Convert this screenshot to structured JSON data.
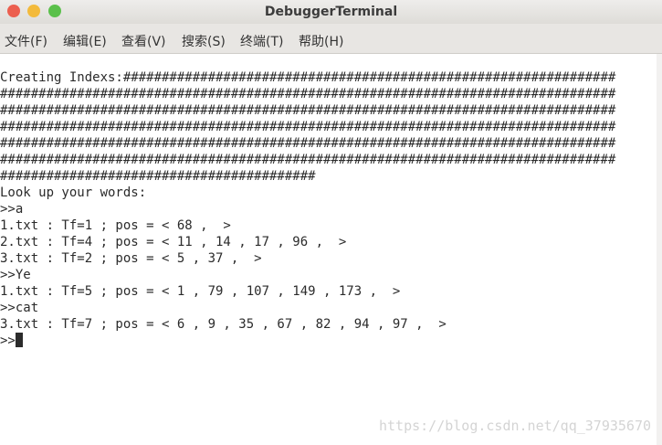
{
  "window": {
    "title": "DebuggerTerminal"
  },
  "menu": [
    "文件(F)",
    "编辑(E)",
    "查看(V)",
    "搜索(S)",
    "终端(T)",
    "帮助(H)"
  ],
  "terminal": {
    "lines": [
      "Creating Indexs:################################################################",
      "################################################################################",
      "################################################################################",
      "################################################################################",
      "################################################################################",
      "################################################################################",
      "#########################################",
      "Look up your words:",
      ">>a",
      "1.txt : Tf=1 ; pos = < 68 ,  >",
      "2.txt : Tf=4 ; pos = < 11 , 14 , 17 , 96 ,  >",
      "3.txt : Tf=2 ; pos = < 5 , 37 ,  >",
      ">>Ye",
      "1.txt : Tf=5 ; pos = < 1 , 79 , 107 , 149 , 173 ,  >",
      ">>cat",
      "3.txt : Tf=7 ; pos = < 6 , 9 , 35 , 67 , 82 , 94 , 97 ,  >"
    ],
    "prompt": ">>"
  },
  "watermark": "https://blog.csdn.net/qq_37935670"
}
